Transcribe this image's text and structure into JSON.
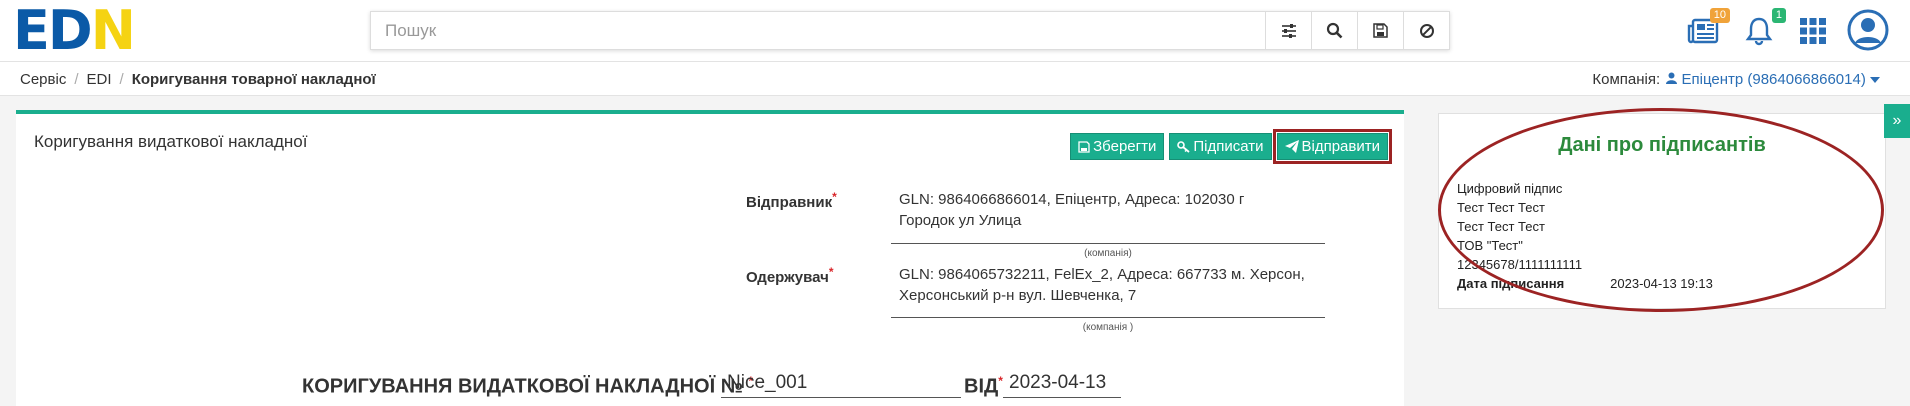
{
  "logo": {
    "e": "E",
    "d": "D",
    "n": "N"
  },
  "search": {
    "placeholder": "Пошук"
  },
  "notifications": {
    "docs_count": "10",
    "bell_count": "1"
  },
  "colors": {
    "accent": "#1aae8e",
    "brand_blue": "#0b5aa7",
    "brand_yellow": "#f5d313",
    "highlight": "#9c2323",
    "signers_title": "#2c8a3c"
  },
  "breadcrumb": {
    "items": [
      "Сервіс",
      "EDI",
      "Коригування товарної накладної"
    ],
    "sep": "/"
  },
  "company": {
    "label": "Компанія:",
    "value": "Епіцентр (9864066866014)"
  },
  "doc": {
    "title": "Коригування видаткової накладної",
    "buttons": {
      "save": "Зберегти",
      "sign": "Підписати",
      "send": "Відправити"
    },
    "sender": {
      "label": "Відправник",
      "line1": "GLN: 9864066866014, Епіцентр, Адреса: 102030 г",
      "line2": "Городок ул Улица",
      "caption": "(компанія)"
    },
    "receiver": {
      "label": "Одержувач",
      "line1": "GLN: 9864065732211, FelEx_2, Адреса: 667733 м. Херсон,",
      "line2": "Херсонський р-н вул. Шевченка, 7",
      "caption": "(компанія )"
    },
    "number": {
      "title": "КОРИГУВАННЯ ВИДАТКОВОЇ НАКЛАДНОЇ №",
      "value": "Nice_001",
      "date_label": "ВІД",
      "date": "2023-04-13"
    }
  },
  "signers": {
    "title": "Дані про підписантів",
    "lines": [
      "Цифровий підпис",
      "Тест Тест Тест",
      "Тест Тест Тест",
      "ТОВ \"Тест\"",
      "12345678/1111111111"
    ],
    "date_label": "Дата підписання",
    "date_value": "2023-04-13 19:13"
  },
  "collapse_icon": "»",
  "required_mark": "*"
}
